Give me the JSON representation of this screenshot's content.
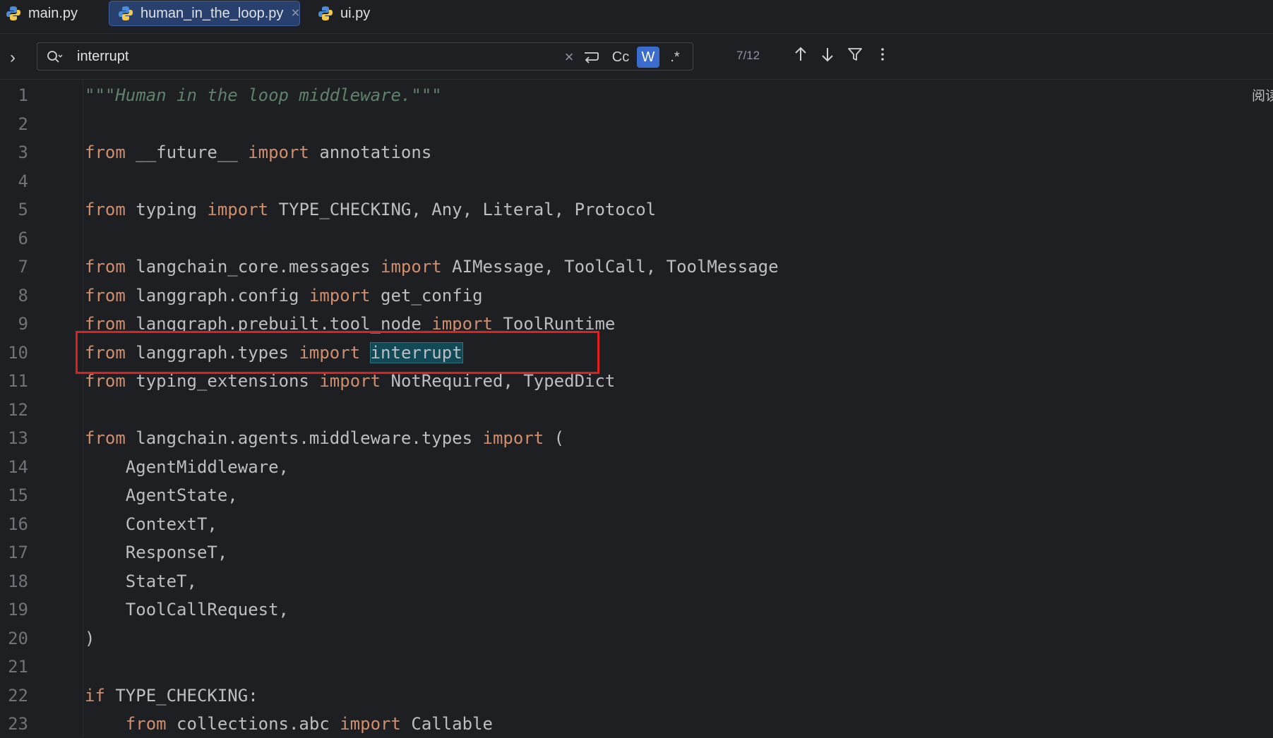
{
  "tabs": [
    {
      "label": "main.py",
      "active": false
    },
    {
      "label": "human_in_the_loop.py",
      "active": true,
      "close": "×"
    },
    {
      "label": "ui.py",
      "active": false
    }
  ],
  "find": {
    "query": "interrupt",
    "clear": "×",
    "case_label": "Cc",
    "word_label": "W",
    "regex_label": ".*",
    "count": "7/12"
  },
  "side_label": "阅读",
  "code": {
    "line_numbers": [
      "1",
      "2",
      "3",
      "4",
      "5",
      "6",
      "7",
      "8",
      "9",
      "10",
      "11",
      "12",
      "13",
      "14",
      "15",
      "16",
      "17",
      "18",
      "19",
      "20",
      "21",
      "22",
      "23"
    ],
    "lines": [
      {
        "doc": "\"\"\"Human in the loop middleware.\"\"\""
      },
      {},
      {
        "kw1": "from",
        "mod": " __future__ ",
        "kw2": "import",
        "names": " annotations"
      },
      {},
      {
        "kw1": "from",
        "mod": " typing ",
        "kw2": "import",
        "names": " TYPE_CHECKING, Any, Literal, Protocol"
      },
      {},
      {
        "kw1": "from",
        "mod": " langchain_core.messages ",
        "kw2": "import",
        "names": " AIMessage, ToolCall, ToolMessage"
      },
      {
        "kw1": "from",
        "mod": " langgraph.config ",
        "kw2": "import",
        "names": " get_config"
      },
      {
        "kw1": "from",
        "mod": " langgraph.prebuilt.tool_node ",
        "kw2": "import",
        "names": " ToolRuntime"
      },
      {
        "kw1": "from",
        "mod": " langgraph.types ",
        "kw2": "import",
        "sp": " ",
        "match": "interrupt"
      },
      {
        "kw1": "from",
        "mod": " typing_extensions ",
        "kw2": "import",
        "names": " NotRequired, TypedDict"
      },
      {},
      {
        "kw1": "from",
        "mod": " langchain.agents.middleware.types ",
        "kw2": "import",
        "names": " ("
      },
      {
        "plain": "    AgentMiddleware,"
      },
      {
        "plain": "    AgentState,"
      },
      {
        "plain": "    ContextT,"
      },
      {
        "plain": "    ResponseT,"
      },
      {
        "plain": "    StateT,"
      },
      {
        "plain": "    ToolCallRequest,"
      },
      {
        "plain": ")"
      },
      {},
      {
        "kw1": "if",
        "mod": " TYPE_CHECKING:"
      },
      {
        "indent": "    ",
        "kw1": "from",
        "mod": " collections.abc ",
        "kw2": "import",
        "names": " Callable"
      }
    ]
  }
}
